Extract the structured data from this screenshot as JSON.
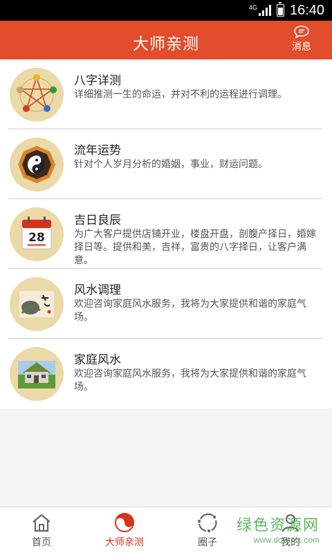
{
  "status_bar": {
    "network": "4G",
    "time": "16:40"
  },
  "header": {
    "title": "大师亲测",
    "message_label": "消息"
  },
  "services": [
    {
      "name": "八字详测",
      "description": "详细推测一生的命运，并对不利的运程进行调理。",
      "icon": "bazi-wuxing-icon"
    },
    {
      "name": "流年运势",
      "description": "针对个人岁月分析的婚姻，事业，财运问题。",
      "icon": "bagua-taiji-icon"
    },
    {
      "name": "吉日良辰",
      "description": "为广大客户提供店铺开业，楼盘开盘，剖腹产择日，婚嫁择日等。提供和美，吉祥，富贵的八字择日，让客户满意。",
      "icon": "calendar-icon",
      "calendar_day": "28"
    },
    {
      "name": "风水调理",
      "description": "欢迎咨询家庭风水服务，我将为大家提供和谐的家庭气场。",
      "icon": "fengshui-painting-icon"
    },
    {
      "name": "家庭风水",
      "description": "欢迎咨询家庭风水服务，我将为大家提供和谐的家庭气场。",
      "icon": "house-icon"
    }
  ],
  "tabs": [
    {
      "label": "首页",
      "icon": "home-icon"
    },
    {
      "label": "大师亲测",
      "icon": "taiji-icon",
      "active": true
    },
    {
      "label": "圈子",
      "icon": "circle-icon"
    },
    {
      "label": "我的",
      "icon": "profile-icon"
    }
  ],
  "watermark": {
    "line1": "绿色资源网",
    "line2": "www.downcc.com"
  },
  "colors": {
    "accent": "#e34d2b",
    "active_tab": "#d8321c",
    "thumb_bg": "#ecd9a8"
  }
}
